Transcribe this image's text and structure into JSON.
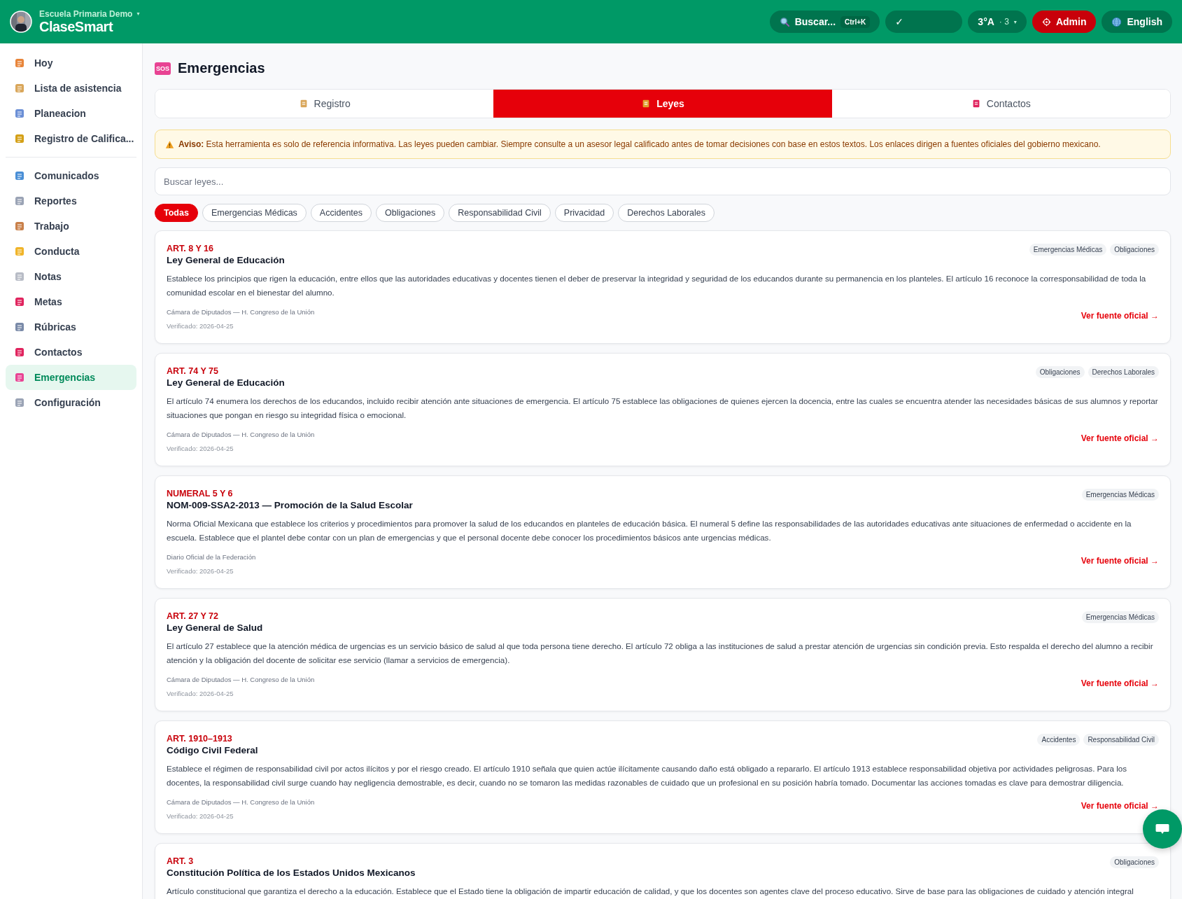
{
  "header": {
    "school": "Escuela Primaria Demo",
    "caret": "▾",
    "app_name": "ClaseSmart",
    "search": {
      "label": "Buscar...",
      "shortcut": "Ctrl+K"
    },
    "status": "✓",
    "class_selector": {
      "label": "3°A",
      "count": "· 3",
      "caret": "▾"
    },
    "admin": "Admin",
    "language": "English"
  },
  "sidebar": {
    "groups": [
      [
        {
          "label": "Hoy",
          "selected": false
        },
        {
          "label": "Lista de asistencia",
          "selected": false
        },
        {
          "label": "Planeacion",
          "selected": false
        },
        {
          "label": "Registro de Califica...",
          "selected": false
        }
      ],
      [
        {
          "label": "Comunicados",
          "selected": false
        },
        {
          "label": "Reportes",
          "selected": false
        },
        {
          "label": "Trabajo",
          "selected": false
        },
        {
          "label": "Conducta",
          "selected": false
        },
        {
          "label": "Notas",
          "selected": false
        },
        {
          "label": "Metas",
          "selected": false
        },
        {
          "label": "Rúbricas",
          "selected": false
        },
        {
          "label": "Contactos",
          "selected": false
        },
        {
          "label": "Emergencias",
          "selected": true
        },
        {
          "label": "Configuración",
          "selected": false
        }
      ]
    ]
  },
  "page": {
    "title": "Emergencias",
    "badge": "SOS"
  },
  "tabs": [
    {
      "label": "Registro",
      "selected": false
    },
    {
      "label": "Leyes",
      "selected": true
    },
    {
      "label": "Contactos",
      "selected": false
    }
  ],
  "notice": "**Aviso:** Esta herramienta es solo de referencia informativa. Las leyes pueden cambiar. Siempre consulte a un asesor legal calificado antes de tomar decisiones con base en estos textos. Los enlaces dirigen a fuentes oficiales del gobierno mexicano.",
  "search": {
    "placeholder": "Buscar leyes..."
  },
  "filters": [
    {
      "label": "Todas",
      "selected": true
    },
    {
      "label": "Emergencias Médicas",
      "selected": false
    },
    {
      "label": "Accidentes",
      "selected": false
    },
    {
      "label": "Obligaciones",
      "selected": false
    },
    {
      "label": "Responsabilidad Civil",
      "selected": false
    },
    {
      "label": "Privacidad",
      "selected": false
    },
    {
      "label": "Derechos Laborales",
      "selected": false
    }
  ],
  "laws": [
    {
      "article": "ART. 8 Y 16",
      "title": "Ley General de Educación",
      "tags": [
        "Emergencias Médicas",
        "Obligaciones"
      ],
      "description": "Establece los principios que rigen la educación, entre ellos que las autoridades educativas y docentes tienen el deber de preservar la integridad y seguridad de los educandos durante su permanencia en los planteles. El artículo 16 reconoce la corresponsabilidad de toda la comunidad escolar en el bienestar del alumno.",
      "source": "Cámara de Diputados — H. Congreso de la Unión",
      "verified": "Verificado: 2026-04-25",
      "link": "Ver fuente oficial →"
    },
    {
      "article": "ART. 74 Y 75",
      "title": "Ley General de Educación",
      "tags": [
        "Obligaciones",
        "Derechos Laborales"
      ],
      "description": "El artículo 74 enumera los derechos de los educandos, incluido recibir atención ante situaciones de emergencia. El artículo 75 establece las obligaciones de quienes ejercen la docencia, entre las cuales se encuentra atender las necesidades básicas de sus alumnos y reportar situaciones que pongan en riesgo su integridad física o emocional.",
      "source": "Cámara de Diputados — H. Congreso de la Unión",
      "verified": "Verificado: 2026-04-25",
      "link": "Ver fuente oficial →"
    },
    {
      "article": "NUMERAL 5 Y 6",
      "title": "NOM-009-SSA2-2013 — Promoción de la Salud Escolar",
      "tags": [
        "Emergencias Médicas"
      ],
      "description": "Norma Oficial Mexicana que establece los criterios y procedimientos para promover la salud de los educandos en planteles de educación básica. El numeral 5 define las responsabilidades de las autoridades educativas ante situaciones de enfermedad o accidente en la escuela. Establece que el plantel debe contar con un plan de emergencias y que el personal docente debe conocer los procedimientos básicos ante urgencias médicas.",
      "source": "Diario Oficial de la Federación",
      "verified": "Verificado: 2026-04-25",
      "link": "Ver fuente oficial →"
    },
    {
      "article": "ART. 27 Y 72",
      "title": "Ley General de Salud",
      "tags": [
        "Emergencias Médicas"
      ],
      "description": "El artículo 27 establece que la atención médica de urgencias es un servicio básico de salud al que toda persona tiene derecho. El artículo 72 obliga a las instituciones de salud a prestar atención de urgencias sin condición previa. Esto respalda el derecho del alumno a recibir atención y la obligación del docente de solicitar ese servicio (llamar a servicios de emergencia).",
      "source": "Cámara de Diputados — H. Congreso de la Unión",
      "verified": "Verificado: 2026-04-25",
      "link": "Ver fuente oficial →"
    },
    {
      "article": "ART. 1910–1913",
      "title": "Código Civil Federal",
      "tags": [
        "Accidentes",
        "Responsabilidad Civil"
      ],
      "description": "Establece el régimen de responsabilidad civil por actos ilícitos y por el riesgo creado. El artículo 1910 señala que quien actúe ilícitamente causando daño está obligado a repararlo. El artículo 1913 establece responsabilidad objetiva por actividades peligrosas. Para los docentes, la responsabilidad civil surge cuando hay negligencia demostrable, es decir, cuando no se tomaron las medidas razonables de cuidado que un profesional en su posición habría tomado. Documentar las acciones tomadas es clave para demostrar diligencia.",
      "source": "Cámara de Diputados — H. Congreso de la Unión",
      "verified": "Verificado: 2026-04-25",
      "link": "Ver fuente oficial →"
    },
    {
      "article": "ART. 3",
      "title": "Constitución Política de los Estados Unidos Mexicanos",
      "tags": [
        "Obligaciones"
      ],
      "description": "Artículo constitucional que garantiza el derecho a la educación. Establece que el Estado tiene la obligación de impartir educación de calidad, y que los docentes son agentes clave del proceso educativo. Sirve de base para las obligaciones de cuidado y atención integral"
    }
  ]
}
